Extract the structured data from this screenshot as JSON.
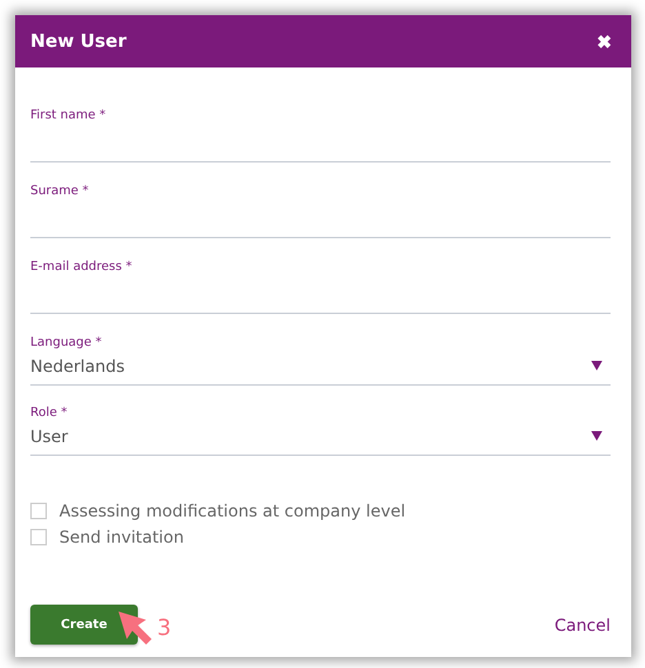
{
  "dialog": {
    "title": "New User",
    "close": "✖"
  },
  "fields": [
    {
      "kind": "text",
      "label": "First name *"
    },
    {
      "kind": "text",
      "label": "Surame *"
    },
    {
      "kind": "text",
      "label": "E-mail address *"
    },
    {
      "kind": "select",
      "label": "Language *",
      "value": "Nederlands"
    },
    {
      "kind": "select",
      "label": "Role *",
      "value": "User"
    }
  ],
  "checkboxes": [
    {
      "label": "Assessing modifications at company level",
      "checked": false
    },
    {
      "label": "Send invitation",
      "checked": false
    }
  ],
  "buttons": {
    "create": "Create",
    "cancel": "Cancel"
  },
  "annotation": {
    "number": "3"
  }
}
